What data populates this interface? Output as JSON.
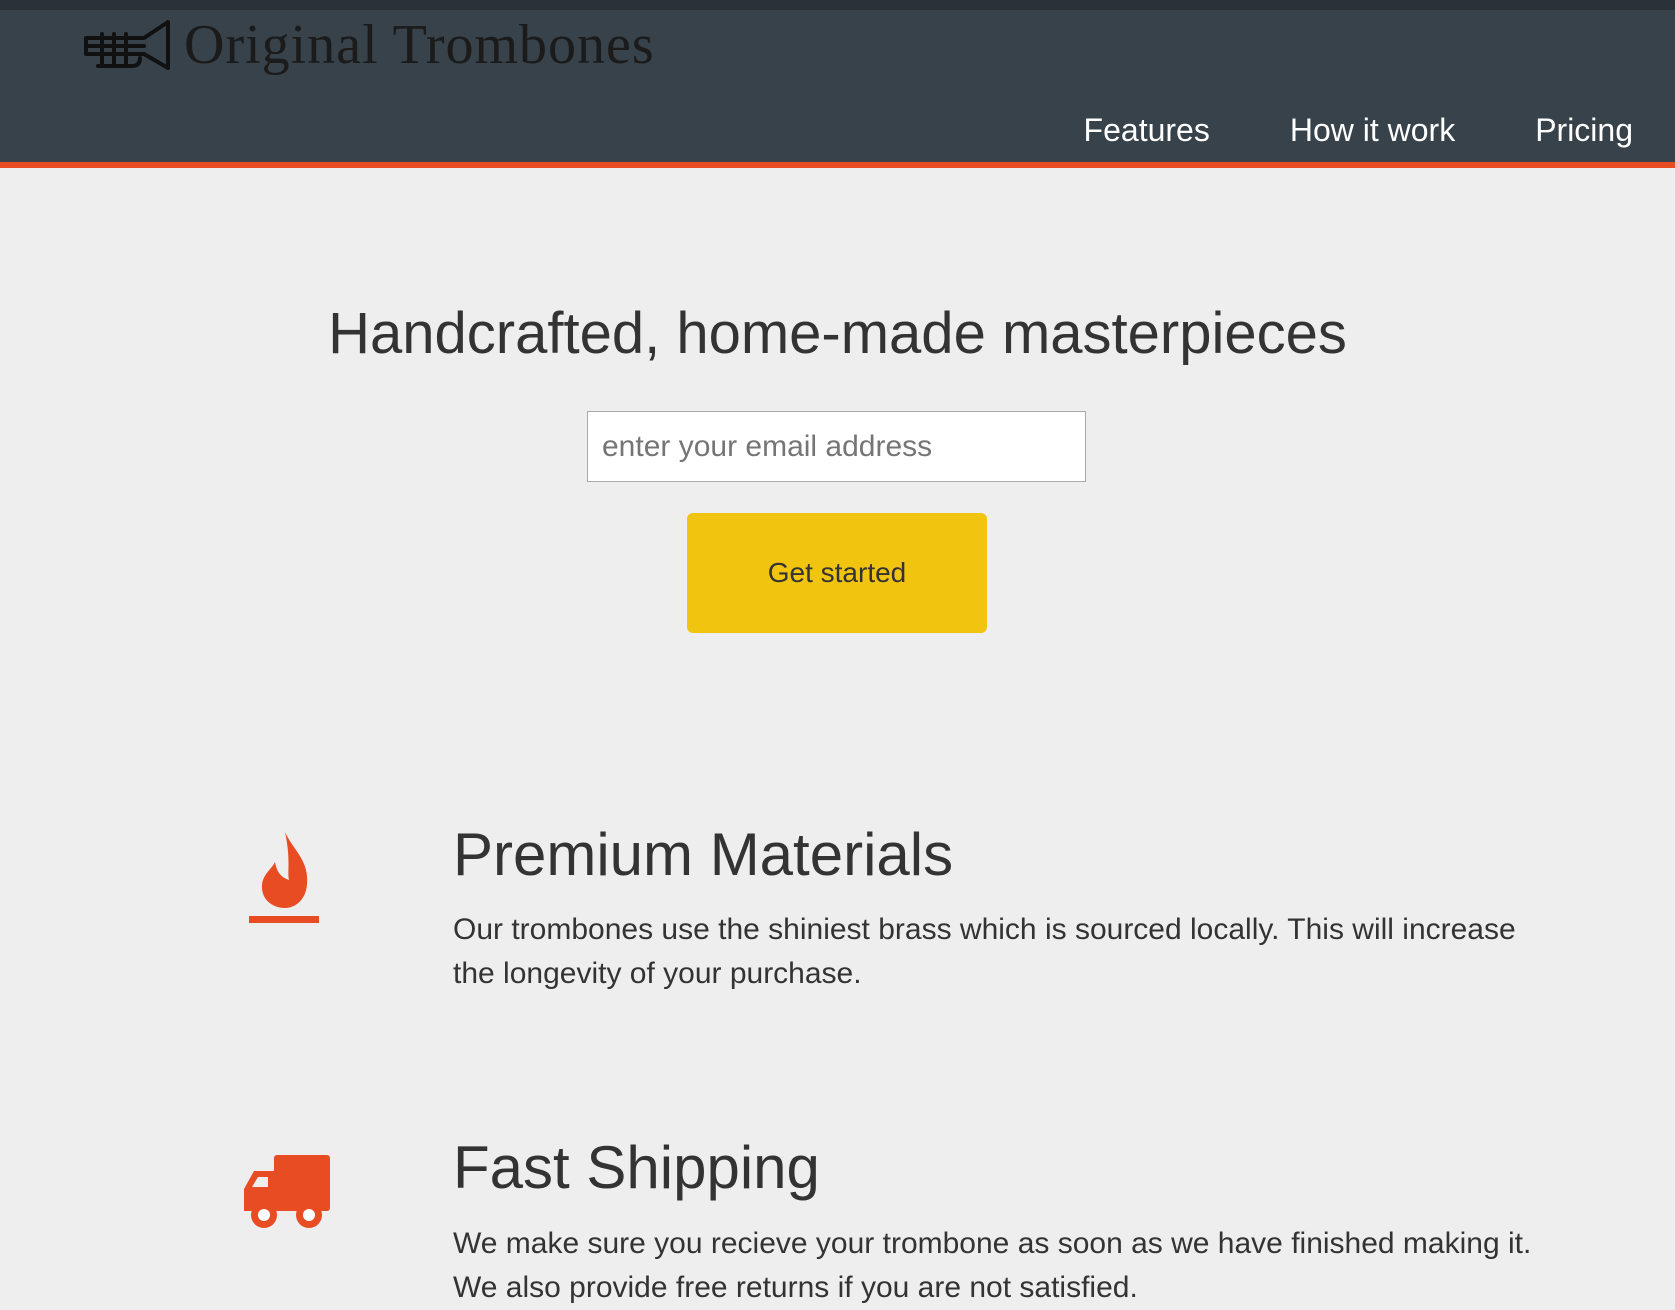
{
  "header": {
    "brand": "Original Trombones",
    "logo_icon": "trumpet-logo-icon",
    "nav": [
      {
        "label": "Features"
      },
      {
        "label": "How it work"
      },
      {
        "label": "Pricing"
      }
    ],
    "colors": {
      "background": "#37424a",
      "accent_border": "#e84c22"
    }
  },
  "hero": {
    "title": "Handcrafted, home-made masterpieces",
    "email_placeholder": "enter your email address",
    "email_value": "",
    "cta_label": "Get started",
    "cta_color": "#f1c40f"
  },
  "features": [
    {
      "icon": "flame-icon",
      "title": "Premium Materials",
      "description": "Our trombones use the shiniest brass which is sourced locally. This will increase the longevity of your purchase."
    },
    {
      "icon": "truck-icon",
      "title": "Fast Shipping",
      "description": "We make sure you recieve your trombone as soon as we have finished making it. We also provide free returns if you are not satisfied."
    }
  ],
  "colors": {
    "page_background": "#eeeeee",
    "icon_color": "#e84c22",
    "text": "#333333"
  }
}
